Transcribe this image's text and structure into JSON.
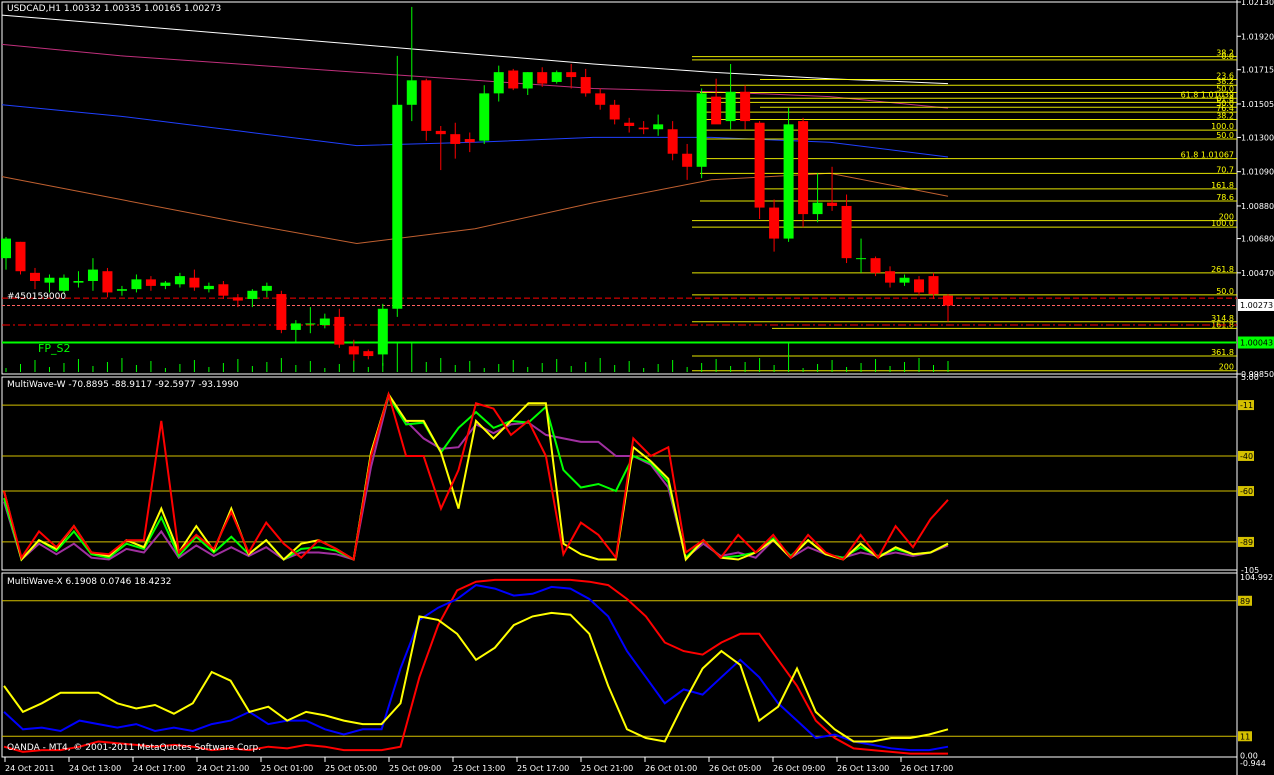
{
  "main_panel": {
    "header": "USDCAD,H1  1.00332 1.00335 1.00165 1.00273",
    "price_labels": [
      "1.02130",
      "1.01920",
      "1.01715",
      "1.01505",
      "1.01300",
      "1.01090",
      "1.00880",
      "1.00680",
      "1.00470",
      "1.00273",
      "1.00043",
      "0.99850"
    ],
    "current_price": "1.00273",
    "line_price_label": "1.00043",
    "fp_label": "FP_S2",
    "order_label": "#450159000",
    "fib_labels": [
      {
        "text": "38.2",
        "color": "#ffff00"
      },
      {
        "text": "0.0",
        "color": "#ffff00"
      },
      {
        "text": "23.6",
        "color": "#ffff00"
      },
      {
        "text": "38.2",
        "color": "#ffff00"
      },
      {
        "text": "50.0",
        "color": "#ffff00"
      },
      {
        "text": "61.8 1.01039",
        "color": "#ffff00"
      },
      {
        "text": "61.8",
        "color": "#ffff00"
      },
      {
        "text": "50.0",
        "color": "#ffff00"
      },
      {
        "text": "76.4",
        "color": "#ffff00"
      },
      {
        "text": "38.2",
        "color": "#ffff00"
      },
      {
        "text": "100.0",
        "color": "#ffff00"
      },
      {
        "text": "50.0",
        "color": "#ffff00"
      },
      {
        "text": "61.8 1.01067",
        "color": "#ffff00"
      },
      {
        "text": "70.7",
        "color": "#ffff00"
      },
      {
        "text": "161.8",
        "color": "#ffff00"
      },
      {
        "text": "78.6",
        "color": "#ffff00"
      },
      {
        "text": "200",
        "color": "#ffff00"
      },
      {
        "text": "100.0",
        "color": "#ffff00"
      },
      {
        "text": "261.8",
        "color": "#ffff00"
      },
      {
        "text": "50.0",
        "color": "#ffff00"
      },
      {
        "text": "314.8",
        "color": "#ffff00"
      },
      {
        "text": "161.8",
        "color": "#ffff00"
      },
      {
        "text": "361.8",
        "color": "#ffff00"
      },
      {
        "text": "200",
        "color": "#ffff00"
      }
    ]
  },
  "wave_w_panel": {
    "header": "MultiWave-W -70.8895 -88.9117 -92.5977 -93.1990",
    "scale_labels": [
      "5.00",
      "-11",
      "-40",
      "-60",
      "-89",
      "-105"
    ]
  },
  "wave_x_panel": {
    "header": "MultiWave-X 6.1908 0.0746 18.4232",
    "footer": "OANDA - MT4, © 2001-2011 MetaQuotes Software Corp.",
    "scale_labels": [
      "104.992",
      "89",
      "11",
      "0.00",
      "-0.944"
    ]
  },
  "time_labels": [
    "24 Oct 2011",
    "24 Oct 13:00",
    "24 Oct 17:00",
    "24 Oct 21:00",
    "25 Oct 01:00",
    "25 Oct 05:00",
    "25 Oct 09:00",
    "25 Oct 13:00",
    "25 Oct 17:00",
    "25 Oct 21:00",
    "26 Oct 01:00",
    "26 Oct 05:00",
    "26 Oct 09:00",
    "26 Oct 13:00",
    "26 Oct 17:00"
  ],
  "colors": {
    "bull": "#00ff00",
    "bear": "#ff0000",
    "fib": "#ffff00",
    "grid": "#ffffff"
  },
  "chart_data": [
    {
      "type": "candlestick",
      "title": "USDCAD,H1",
      "ylim": [
        0.9985,
        1.0213
      ],
      "candles": [
        {
          "o": 1.0056,
          "h": 1.0069,
          "l": 1.0049,
          "c": 1.0068
        },
        {
          "o": 1.0066,
          "h": 1.0066,
          "l": 1.0046,
          "c": 1.0048
        },
        {
          "o": 1.0047,
          "h": 1.005,
          "l": 1.0037,
          "c": 1.0042
        },
        {
          "o": 1.0041,
          "h": 1.0046,
          "l": 1.0035,
          "c": 1.0044
        },
        {
          "o": 1.0036,
          "h": 1.0046,
          "l": 1.0034,
          "c": 1.0044
        },
        {
          "o": 1.0041,
          "h": 1.0048,
          "l": 1.0038,
          "c": 1.0042
        },
        {
          "o": 1.0042,
          "h": 1.0056,
          "l": 1.0036,
          "c": 1.0049
        },
        {
          "o": 1.0048,
          "h": 1.005,
          "l": 1.0032,
          "c": 1.0035
        },
        {
          "o": 1.0036,
          "h": 1.0039,
          "l": 1.0033,
          "c": 1.0037
        },
        {
          "o": 1.0037,
          "h": 1.0046,
          "l": 1.0035,
          "c": 1.0043
        },
        {
          "o": 1.0043,
          "h": 1.0045,
          "l": 1.0036,
          "c": 1.0039
        },
        {
          "o": 1.0039,
          "h": 1.0042,
          "l": 1.0037,
          "c": 1.0041
        },
        {
          "o": 1.004,
          "h": 1.0047,
          "l": 1.0038,
          "c": 1.0045
        },
        {
          "o": 1.0044,
          "h": 1.0049,
          "l": 1.0036,
          "c": 1.0038
        },
        {
          "o": 1.0037,
          "h": 1.0041,
          "l": 1.0035,
          "c": 1.0039
        },
        {
          "o": 1.004,
          "h": 1.0042,
          "l": 1.0031,
          "c": 1.0033
        },
        {
          "o": 1.0032,
          "h": 1.0034,
          "l": 1.0026,
          "c": 1.003
        },
        {
          "o": 1.0031,
          "h": 1.0037,
          "l": 1.0026,
          "c": 1.0036
        },
        {
          "o": 1.0036,
          "h": 1.0041,
          "l": 1.0032,
          "c": 1.0039
        },
        {
          "o": 1.0034,
          "h": 1.0036,
          "l": 1.001,
          "c": 1.0012
        },
        {
          "o": 1.0012,
          "h": 1.0018,
          "l": 1.0004,
          "c": 1.0016
        },
        {
          "o": 1.0016,
          "h": 1.0026,
          "l": 1.001,
          "c": 1.0016
        },
        {
          "o": 1.0015,
          "h": 1.0022,
          "l": 1.0013,
          "c": 1.0019
        },
        {
          "o": 1.002,
          "h": 1.0025,
          "l": 1.0001,
          "c": 1.0003
        },
        {
          "o": 1.0002,
          "h": 1.0006,
          "l": 0.9993,
          "c": 0.9997
        },
        {
          "o": 0.9999,
          "h": 1.0,
          "l": 0.9994,
          "c": 0.9996
        },
        {
          "o": 0.9997,
          "h": 1.0028,
          "l": 0.999,
          "c": 1.0025
        },
        {
          "o": 1.0025,
          "h": 1.018,
          "l": 1.002,
          "c": 1.015
        },
        {
          "o": 1.015,
          "h": 1.021,
          "l": 1.014,
          "c": 1.0165
        },
        {
          "o": 1.0165,
          "h": 1.0166,
          "l": 1.0128,
          "c": 1.0134
        },
        {
          "o": 1.0134,
          "h": 1.0137,
          "l": 1.011,
          "c": 1.0132
        },
        {
          "o": 1.0132,
          "h": 1.0139,
          "l": 1.0117,
          "c": 1.0126
        },
        {
          "o": 1.0129,
          "h": 1.0133,
          "l": 1.0121,
          "c": 1.0127
        },
        {
          "o": 1.0128,
          "h": 1.0162,
          "l": 1.0126,
          "c": 1.0157
        },
        {
          "o": 1.0157,
          "h": 1.0174,
          "l": 1.0152,
          "c": 1.017
        },
        {
          "o": 1.0171,
          "h": 1.0172,
          "l": 1.0159,
          "c": 1.016
        },
        {
          "o": 1.016,
          "h": 1.017,
          "l": 1.0156,
          "c": 1.017
        },
        {
          "o": 1.017,
          "h": 1.0173,
          "l": 1.0161,
          "c": 1.0163
        },
        {
          "o": 1.0164,
          "h": 1.0171,
          "l": 1.0163,
          "c": 1.017
        },
        {
          "o": 1.017,
          "h": 1.0175,
          "l": 1.016,
          "c": 1.0167
        },
        {
          "o": 1.0167,
          "h": 1.0172,
          "l": 1.0155,
          "c": 1.0157
        },
        {
          "o": 1.0157,
          "h": 1.016,
          "l": 1.0147,
          "c": 1.015
        },
        {
          "o": 1.015,
          "h": 1.0153,
          "l": 1.0138,
          "c": 1.0141
        },
        {
          "o": 1.0139,
          "h": 1.0142,
          "l": 1.0133,
          "c": 1.0137
        },
        {
          "o": 1.0136,
          "h": 1.014,
          "l": 1.0132,
          "c": 1.0135
        },
        {
          "o": 1.0135,
          "h": 1.0144,
          "l": 1.0131,
          "c": 1.0138
        },
        {
          "o": 1.0135,
          "h": 1.014,
          "l": 1.0116,
          "c": 1.012
        },
        {
          "o": 1.012,
          "h": 1.0126,
          "l": 1.0104,
          "c": 1.0112
        },
        {
          "o": 1.0112,
          "h": 1.016,
          "l": 1.0105,
          "c": 1.0157
        },
        {
          "o": 1.0155,
          "h": 1.0166,
          "l": 1.014,
          "c": 1.0138
        },
        {
          "o": 1.014,
          "h": 1.0175,
          "l": 1.0135,
          "c": 1.0158
        },
        {
          "o": 1.0158,
          "h": 1.0162,
          "l": 1.0135,
          "c": 1.014
        },
        {
          "o": 1.0139,
          "h": 1.014,
          "l": 1.008,
          "c": 1.0087
        },
        {
          "o": 1.0087,
          "h": 1.0092,
          "l": 1.006,
          "c": 1.0068
        },
        {
          "o": 1.0068,
          "h": 1.0148,
          "l": 1.0066,
          "c": 1.0138
        },
        {
          "o": 1.014,
          "h": 1.0142,
          "l": 1.0075,
          "c": 1.0083
        },
        {
          "o": 1.0083,
          "h": 1.0108,
          "l": 1.0078,
          "c": 1.009
        },
        {
          "o": 1.009,
          "h": 1.0112,
          "l": 1.0085,
          "c": 1.0088
        },
        {
          "o": 1.0088,
          "h": 1.0095,
          "l": 1.0053,
          "c": 1.0056
        },
        {
          "o": 1.0056,
          "h": 1.0068,
          "l": 1.0047,
          "c": 1.0056
        },
        {
          "o": 1.0056,
          "h": 1.0057,
          "l": 1.0045,
          "c": 1.0047
        },
        {
          "o": 1.0048,
          "h": 1.0051,
          "l": 1.0038,
          "c": 1.0041
        },
        {
          "o": 1.0041,
          "h": 1.0046,
          "l": 1.0039,
          "c": 1.0044
        },
        {
          "o": 1.0043,
          "h": 1.0045,
          "l": 1.0033,
          "c": 1.0035
        },
        {
          "o": 1.0045,
          "h": 1.0047,
          "l": 1.0031,
          "c": 1.0034
        },
        {
          "o": 1.0033,
          "h": 1.0034,
          "l": 1.0017,
          "c": 1.0027
        }
      ],
      "ma_series": [
        {
          "color": "#ffffff",
          "values": [
            1.0205,
            1.0199,
            1.0193,
            1.0187,
            1.0181,
            1.0175,
            1.017,
            1.0166,
            1.0163
          ]
        },
        {
          "color": "#c0307c",
          "values": [
            1.0187,
            1.018,
            1.0175,
            1.017,
            1.0165,
            1.016,
            1.0158,
            1.0155,
            1.0148
          ]
        },
        {
          "color": "#2040ff",
          "values": [
            1.015,
            1.0143,
            1.0134,
            1.0125,
            1.0127,
            1.013,
            1.013,
            1.0127,
            1.0118
          ]
        },
        {
          "color": "#c06030",
          "values": [
            1.0106,
            1.0092,
            1.0078,
            1.0065,
            1.0074,
            1.009,
            1.0104,
            1.0108,
            1.0094
          ]
        }
      ]
    },
    {
      "type": "line",
      "title": "MultiWave-W",
      "ylim": [
        -105,
        5
      ],
      "series": [
        {
          "color": "#ff0000",
          "values": [
            -60,
            -98,
            -83,
            -92,
            -80,
            -95,
            -96,
            -88,
            -88,
            -20,
            -95,
            -85,
            -93,
            -72,
            -95,
            -78,
            -90,
            -98,
            -88,
            -93,
            -99,
            -40,
            -5,
            -40,
            -40,
            -70,
            -48,
            -10,
            -13,
            -28,
            -20,
            -40,
            -96,
            -78,
            -85,
            -98,
            -30,
            -40,
            -35,
            -95,
            -88,
            -98,
            -85,
            -95,
            -85,
            -98,
            -85,
            -95,
            -99,
            -85,
            -98,
            -80,
            -92,
            -76,
            -65
          ]
        },
        {
          "color": "#ffff00",
          "values": [
            -60,
            -99,
            -88,
            -93,
            -80,
            -95,
            -97,
            -88,
            -92,
            -70,
            -95,
            -80,
            -94,
            -70,
            -96,
            -88,
            -99,
            -90,
            -88,
            -93,
            -99,
            -38,
            -5,
            -20,
            -20,
            -38,
            -70,
            -20,
            -30,
            -20,
            -10,
            -10,
            -90,
            -96,
            -99,
            -99,
            -35,
            -43,
            -53,
            -99,
            -88,
            -98,
            -99,
            -95,
            -88,
            -98,
            -88,
            -96,
            -99,
            -90,
            -98,
            -92,
            -96,
            -95,
            -90
          ]
        },
        {
          "color": "#00ff00",
          "values": [
            -64,
            -99,
            -88,
            -94,
            -83,
            -96,
            -98,
            -90,
            -93,
            -75,
            -97,
            -86,
            -95,
            -86,
            -96,
            -88,
            -99,
            -93,
            -92,
            -94,
            -99,
            -38,
            -6,
            -22,
            -21,
            -38,
            -24,
            -15,
            -24,
            -20,
            -21,
            -12,
            -48,
            -58,
            -56,
            -60,
            -40,
            -44,
            -55,
            -98,
            -88,
            -98,
            -97,
            -95,
            -87,
            -97,
            -88,
            -96,
            -98,
            -92,
            -97,
            -93,
            -96,
            -95,
            -90
          ]
        },
        {
          "color": "#a030a0",
          "values": [
            -66,
            -99,
            -90,
            -96,
            -90,
            -98,
            -99,
            -93,
            -95,
            -83,
            -98,
            -91,
            -97,
            -92,
            -97,
            -92,
            -99,
            -95,
            -95,
            -96,
            -99,
            -46,
            -6,
            -20,
            -30,
            -36,
            -35,
            -22,
            -27,
            -22,
            -21,
            -28,
            -30,
            -32,
            -32,
            -40,
            -40,
            -45,
            -58,
            -98,
            -90,
            -97,
            -95,
            -98,
            -88,
            -98,
            -92,
            -96,
            -98,
            -95,
            -97,
            -95,
            -97,
            -95,
            -91
          ]
        }
      ]
    },
    {
      "type": "line",
      "title": "MultiWave-X",
      "ylim": [
        -0.944,
        104.992
      ],
      "series": [
        {
          "color": "#ff0000",
          "values": [
            5,
            2,
            3,
            3,
            5,
            8,
            7,
            6,
            5,
            6,
            5,
            3,
            4,
            3,
            5,
            4,
            6,
            5,
            3,
            3,
            3,
            5,
            45,
            75,
            95,
            100,
            101,
            101,
            101,
            101,
            101,
            100,
            98,
            90,
            80,
            65,
            60,
            58,
            65,
            70,
            70,
            55,
            40,
            20,
            10,
            4,
            3,
            2,
            1,
            1,
            1
          ]
        },
        {
          "color": "#0000ff",
          "values": [
            25,
            15,
            16,
            14,
            20,
            18,
            16,
            18,
            14,
            16,
            14,
            18,
            20,
            25,
            18,
            20,
            20,
            15,
            12,
            15,
            15,
            50,
            78,
            85,
            90,
            98,
            96,
            92,
            93,
            97,
            96,
            90,
            80,
            60,
            45,
            30,
            38,
            35,
            45,
            55,
            45,
            30,
            20,
            10,
            12,
            8,
            6,
            4,
            3,
            3,
            5
          ]
        },
        {
          "color": "#ffff00",
          "values": [
            40,
            25,
            30,
            36,
            36,
            36,
            30,
            27,
            29,
            24,
            30,
            48,
            43,
            25,
            28,
            20,
            25,
            23,
            20,
            18,
            18,
            30,
            80,
            78,
            70,
            55,
            62,
            75,
            80,
            82,
            81,
            70,
            40,
            15,
            10,
            8,
            30,
            50,
            60,
            52,
            20,
            28,
            50,
            25,
            15,
            8,
            8,
            10,
            10,
            12,
            15
          ]
        }
      ]
    }
  ]
}
